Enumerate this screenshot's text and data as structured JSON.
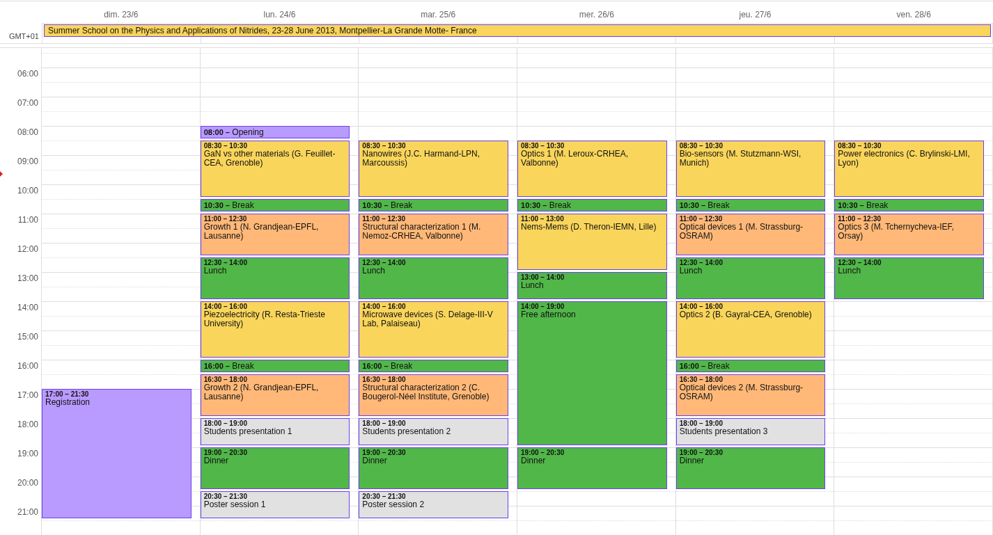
{
  "timezone": "GMT+01",
  "all_day": [
    {
      "title": "Summer School on the Physics and Applications of Nitrides, 23-28 June 2013, Montpellier-La Grande Motte- France",
      "color": "#f9d55b"
    }
  ],
  "hours": [
    "06:00",
    "07:00",
    "08:00",
    "09:00",
    "10:00",
    "11:00",
    "12:00",
    "13:00",
    "14:00",
    "15:00",
    "16:00",
    "17:00",
    "18:00",
    "19:00",
    "20:00",
    "21:00"
  ],
  "days": [
    {
      "label": "dim. 23/6",
      "events": [
        {
          "kind": "long",
          "time": "17:00 – 21:30",
          "title": "Registration",
          "color": "#b99aff"
        }
      ]
    },
    {
      "label": "lun. 24/6",
      "events": [
        {
          "kind": "short",
          "label": "**08:00 –** Opening",
          "color": "#b99aff"
        },
        {
          "kind": "long",
          "time": "08:30 – 10:30",
          "title": "GaN vs other materials (G. Feuillet-CEA, Grenoble)",
          "color": "#f9d55b"
        },
        {
          "kind": "short",
          "label": "**10:30 –** Break",
          "color": "#51b749"
        },
        {
          "kind": "long",
          "time": "11:00 – 12:30",
          "title": "Growth 1 (N. Grandjean-EPFL, Lausanne)",
          "color": "#ffb878"
        },
        {
          "kind": "long",
          "time": "12:30 – 14:00",
          "title": "Lunch",
          "color": "#51b749"
        },
        {
          "kind": "long",
          "time": "14:00 – 16:00",
          "title": "Piezoelectricity (R. Resta-Trieste University)",
          "color": "#f9d55b"
        },
        {
          "kind": "short",
          "label": "**16:00 –** Break",
          "color": "#51b749"
        },
        {
          "kind": "long",
          "time": "16:30 – 18:00",
          "title": "Growth 2 (N. Grandjean-EPFL, Lausanne)",
          "color": "#ffb878"
        },
        {
          "kind": "long",
          "time": "18:00 – 19:00",
          "title": "Students presentation 1",
          "color": "#e1e1e1"
        },
        {
          "kind": "long",
          "time": "19:00 – 20:30",
          "title": "Dinner",
          "color": "#51b749"
        },
        {
          "kind": "long",
          "time": "20:30 – 21:30",
          "title": "Poster session 1",
          "color": "#e1e1e1"
        }
      ]
    },
    {
      "label": "mar. 25/6",
      "events": [
        {
          "kind": "long",
          "time": "08:30 – 10:30",
          "title": "Nanowires (J.C. Harmand-LPN, Marcoussis)",
          "color": "#f9d55b"
        },
        {
          "kind": "short",
          "label": "**10:30 –** Break",
          "color": "#51b749"
        },
        {
          "kind": "long",
          "time": "11:00 – 12:30",
          "title": "Structural characterization 1 (M. Nemoz-CRHEA, Valbonne)",
          "color": "#ffb878"
        },
        {
          "kind": "long",
          "time": "12:30 – 14:00",
          "title": "Lunch",
          "color": "#51b749"
        },
        {
          "kind": "long",
          "time": "14:00 – 16:00",
          "title": "Microwave devices (S. Delage-III-V Lab, Palaiseau)",
          "color": "#f9d55b"
        },
        {
          "kind": "short",
          "label": "**16:00 –** Break",
          "color": "#51b749"
        },
        {
          "kind": "long",
          "time": "16:30 – 18:00",
          "title": "Structural characterization 2 (C. Bougerol-Néel Institute, Grenoble)",
          "color": "#ffb878"
        },
        {
          "kind": "long",
          "time": "18:00 – 19:00",
          "title": "Students presentation 2",
          "color": "#e1e1e1"
        },
        {
          "kind": "long",
          "time": "19:00 – 20:30",
          "title": "Dinner",
          "color": "#51b749"
        },
        {
          "kind": "long",
          "time": "20:30 – 21:30",
          "title": "Poster session 2",
          "color": "#e1e1e1"
        }
      ]
    },
    {
      "label": "mer. 26/6",
      "events": [
        {
          "kind": "long",
          "time": "08:30 – 10:30",
          "title": "Optics 1 (M. Leroux-CRHEA, Valbonne)",
          "color": "#f9d55b"
        },
        {
          "kind": "short",
          "label": "**10:30 –** Break",
          "color": "#51b749"
        },
        {
          "kind": "long",
          "time": "11:00 – 13:00",
          "title": "Nems-Mems (D. Theron-IEMN, Lille)",
          "color": "#f9d55b"
        },
        {
          "kind": "long",
          "time": "13:00 – 14:00",
          "title": "Lunch",
          "color": "#51b749"
        },
        {
          "kind": "long",
          "time": "14:00 – 19:00",
          "title": "Free afternoon",
          "color": "#51b749"
        },
        {
          "kind": "long",
          "time": "19:00 – 20:30",
          "title": "Dinner",
          "color": "#51b749"
        }
      ]
    },
    {
      "label": "jeu. 27/6",
      "events": [
        {
          "kind": "long",
          "time": "08:30 – 10:30",
          "title": "Bio-sensors (M. Stutzmann-WSI, Munich)",
          "color": "#f9d55b"
        },
        {
          "kind": "short",
          "label": "**10:30 –** Break",
          "color": "#51b749"
        },
        {
          "kind": "long",
          "time": "11:00 – 12:30",
          "title": "Optical devices 1 (M. Strassburg-OSRAM)",
          "color": "#ffb878"
        },
        {
          "kind": "long",
          "time": "12:30 – 14:00",
          "title": "Lunch",
          "color": "#51b749"
        },
        {
          "kind": "long",
          "time": "14:00 – 16:00",
          "title": "Optics 2 (B. Gayral-CEA, Grenoble)",
          "color": "#f9d55b"
        },
        {
          "kind": "short",
          "label": "**16:00 –** Break",
          "color": "#51b749"
        },
        {
          "kind": "long",
          "time": "16:30 – 18:00",
          "title": "Optical devices 2 (M. Strassburg-OSRAM)",
          "color": "#ffb878"
        },
        {
          "kind": "long",
          "time": "18:00 – 19:00",
          "title": "Students presentation 3",
          "color": "#e1e1e1"
        },
        {
          "kind": "long",
          "time": "19:00 – 20:30",
          "title": "Dinner",
          "color": "#51b749"
        }
      ]
    },
    {
      "label": "ven. 28/6",
      "events": [
        {
          "kind": "long",
          "time": "08:30 – 10:30",
          "title": "Power electronics (C. Brylinski-LMI, Lyon)",
          "color": "#f9d55b"
        },
        {
          "kind": "short",
          "label": "**10:30 –** Break",
          "color": "#51b749"
        },
        {
          "kind": "long",
          "time": "11:00 – 12:30",
          "title": "Optics 3 (M. Tchernycheva-IEF, Orsay)",
          "color": "#ffb878"
        },
        {
          "kind": "long",
          "time": "12:30 – 14:00",
          "title": "Lunch",
          "color": "#51b749"
        }
      ]
    }
  ]
}
